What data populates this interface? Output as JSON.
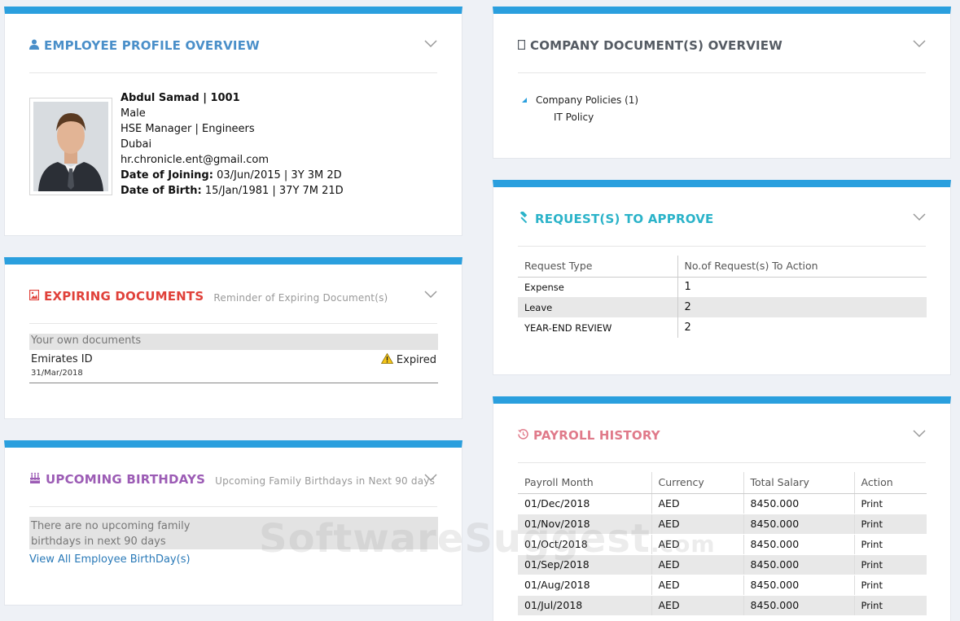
{
  "colors": {
    "accent_bar": "#2a9fde",
    "profile_title": "#4a8fc9",
    "company_title": "#555b63",
    "requests_title": "#2bb3c9",
    "expiring_title": "#e0413a",
    "birthdays_title": "#9c5cb5",
    "payroll_title": "#e07a8a",
    "link": "#2a7ab8"
  },
  "profile": {
    "title": "EMPLOYEE PROFILE OVERVIEW",
    "icon": "user-icon",
    "name_id": "Abdul Samad | 1001",
    "gender": "Male",
    "position": "HSE Manager | Engineers",
    "location": "Dubai",
    "email": "hr.chronicle.ent@gmail.com",
    "doj_label": "Date of Joining:",
    "doj_value": "03/Jun/2015 | 3Y 3M 2D",
    "dob_label": "Date of Birth:",
    "dob_value": "15/Jan/1981 | 37Y 7M 21D"
  },
  "expiring": {
    "title": "EXPIRING DOCUMENTS",
    "subtitle": "Reminder of Expiring Document(s)",
    "icon": "document-image-icon",
    "group_label": "Your own documents",
    "doc_name": "Emirates ID",
    "doc_date": "31/Mar/2018",
    "doc_status": "Expired",
    "status_icon": "warning-icon"
  },
  "birthdays": {
    "title": "UPCOMING BIRTHDAYS",
    "subtitle": "Upcoming Family Birthdays in Next 90 days",
    "icon": "cake-icon",
    "empty_line1": "There are no upcoming family",
    "empty_line2": "birthdays in next 90 days",
    "link": "View All Employee BirthDay(s)"
  },
  "company_docs": {
    "title": "COMPANY DOCUMENT(S) OVERVIEW",
    "icon": "document-icon",
    "folder": "Company Policies (1)",
    "item": "IT Policy"
  },
  "requests": {
    "title": "REQUEST(S) TO APPROVE",
    "icon": "gavel-icon",
    "headers": [
      "Request Type",
      "No.of Request(s) To Action"
    ],
    "rows": [
      {
        "type": "Expense",
        "count": "1"
      },
      {
        "type": "Leave",
        "count": "2"
      },
      {
        "type": "YEAR-END REVIEW",
        "count": "2"
      }
    ]
  },
  "payroll": {
    "title": "PAYROLL HISTORY",
    "icon": "history-icon",
    "headers": [
      "Payroll Month",
      "Currency",
      "Total Salary",
      "Action"
    ],
    "rows": [
      {
        "month": "01/Dec/2018",
        "currency": "AED",
        "salary": "8450.000",
        "action": "Print"
      },
      {
        "month": "01/Nov/2018",
        "currency": "AED",
        "salary": "8450.000",
        "action": "Print"
      },
      {
        "month": "01/Oct/2018",
        "currency": "AED",
        "salary": "8450.000",
        "action": "Print"
      },
      {
        "month": "01/Sep/2018",
        "currency": "AED",
        "salary": "8450.000",
        "action": "Print"
      },
      {
        "month": "01/Aug/2018",
        "currency": "AED",
        "salary": "8450.000",
        "action": "Print"
      },
      {
        "month": "01/Jul/2018",
        "currency": "AED",
        "salary": "8450.000",
        "action": "Print"
      }
    ]
  },
  "watermark": {
    "main": "SoftwareSuggest",
    "tld": ".com"
  }
}
